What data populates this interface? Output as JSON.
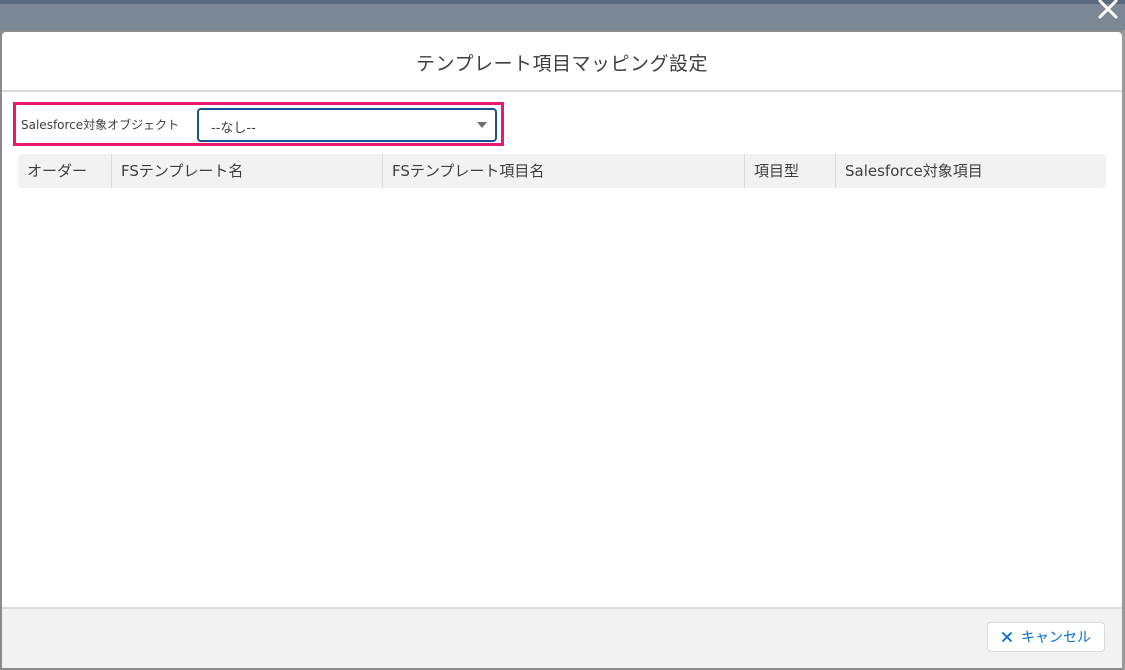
{
  "modal": {
    "title": "テンプレート項目マッピング設定"
  },
  "object_selector": {
    "label": "Salesforce対象オブジェクト",
    "selected": "--なし--"
  },
  "table": {
    "columns": [
      "オーダー",
      "FSテンプレート名",
      "FSテンプレート項目名",
      "項目型",
      "Salesforce対象項目"
    ],
    "rows": []
  },
  "footer": {
    "cancel_label": "キャンセル"
  },
  "icons": {
    "close": "close-icon",
    "cancel": "cross-icon",
    "select_arrow": "triangle-down-icon"
  },
  "colors": {
    "highlight_border": "#e8196e",
    "select_focus_border": "#1b5297",
    "link_blue": "#0070d2"
  }
}
